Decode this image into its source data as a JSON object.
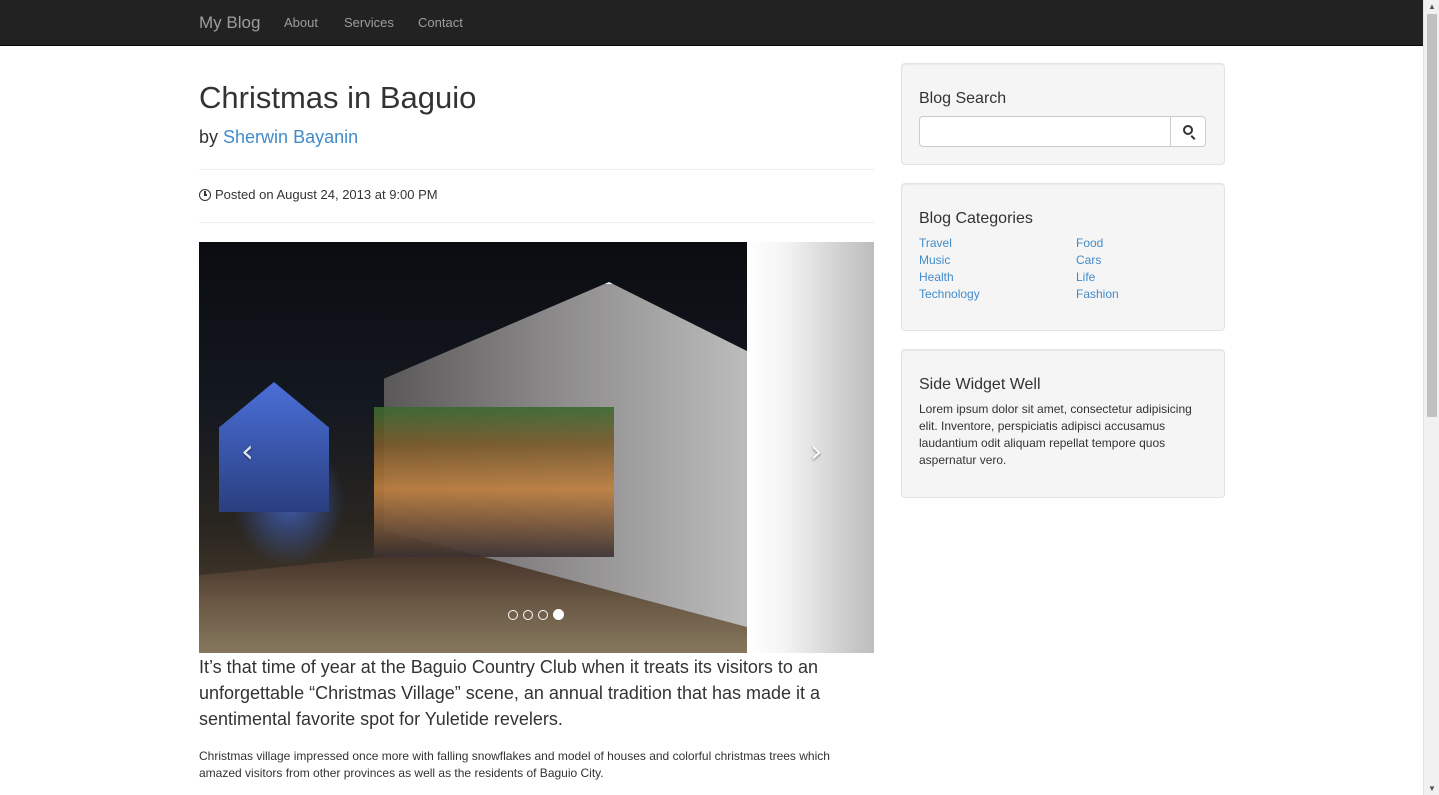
{
  "navbar": {
    "brand": "My Blog",
    "links": [
      "About",
      "Services",
      "Contact"
    ]
  },
  "post": {
    "title": "Christmas in Baguio",
    "by_prefix": "by",
    "author": "Sherwin Bayanin",
    "posted": "Posted on August 24, 2013 at 9:00 PM",
    "lead": "It’s that time of year at the Baguio Country Club when it treats its visitors to an unforgettable “Christmas Village” scene, an annual tradition that has made it a sentimental favorite spot for Yuletide revelers.",
    "paragraph": "Christmas village impressed once more with falling snowflakes and model of houses and colorful christmas trees which amazed visitors from other provinces as well as the residents of Baguio City."
  },
  "carousel": {
    "prev": "‹",
    "next": "›",
    "slide_count": 4,
    "active_slide": 4
  },
  "sidebar": {
    "search": {
      "title": "Blog Search",
      "placeholder": "",
      "value": ""
    },
    "categories": {
      "title": "Blog Categories",
      "left": [
        "Travel",
        "Music",
        "Health",
        "Technology"
      ],
      "right": [
        "Food",
        "Cars",
        "Life",
        "Fashion"
      ]
    },
    "widget": {
      "title": "Side Widget Well",
      "text": "Lorem ipsum dolor sit amet, consectetur adipisicing elit. Inventore, perspiciatis adipisci accusamus laudantium odit aliquam repellat tempore quos aspernatur vero."
    }
  },
  "colors": {
    "navbar": "#222222",
    "link": "#428bca",
    "well": "#f5f5f5"
  }
}
